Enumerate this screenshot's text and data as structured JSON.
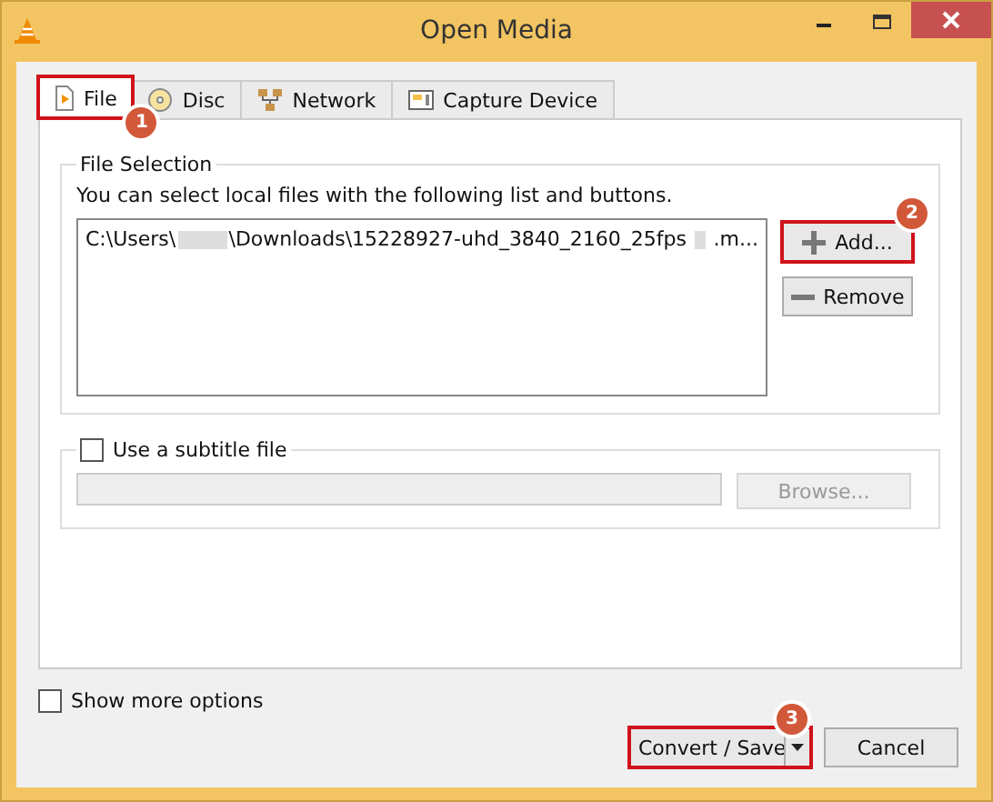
{
  "window": {
    "title": "Open Media"
  },
  "tabs": [
    {
      "label": "File",
      "selected": true,
      "callout": "1"
    },
    {
      "label": "Disc",
      "selected": false
    },
    {
      "label": "Network",
      "selected": false
    },
    {
      "label": "Capture Device",
      "selected": false
    }
  ],
  "file_selection": {
    "title": "File Selection",
    "hint": "You can select local files with the following list and buttons.",
    "files": [
      {
        "path_parts": [
          "C:\\Users\\",
          "\\Downloads\\15228927-uhd_3840_2160_25fps",
          ".m..."
        ]
      }
    ],
    "buttons": [
      {
        "kind": "add",
        "label": "Add...",
        "callout": "2"
      },
      {
        "kind": "remove",
        "label": "Remove"
      }
    ]
  },
  "subtitle": {
    "label": "Use a subtitle file",
    "checked": false,
    "disabled": true,
    "browse": "Browse..."
  },
  "show_more_options": {
    "label": "Show more options",
    "checked": false
  },
  "footer_buttons": [
    {
      "kind": "split",
      "label": "Convert / Save",
      "callout": "3"
    },
    {
      "kind": "plain",
      "label": "Cancel"
    }
  ]
}
